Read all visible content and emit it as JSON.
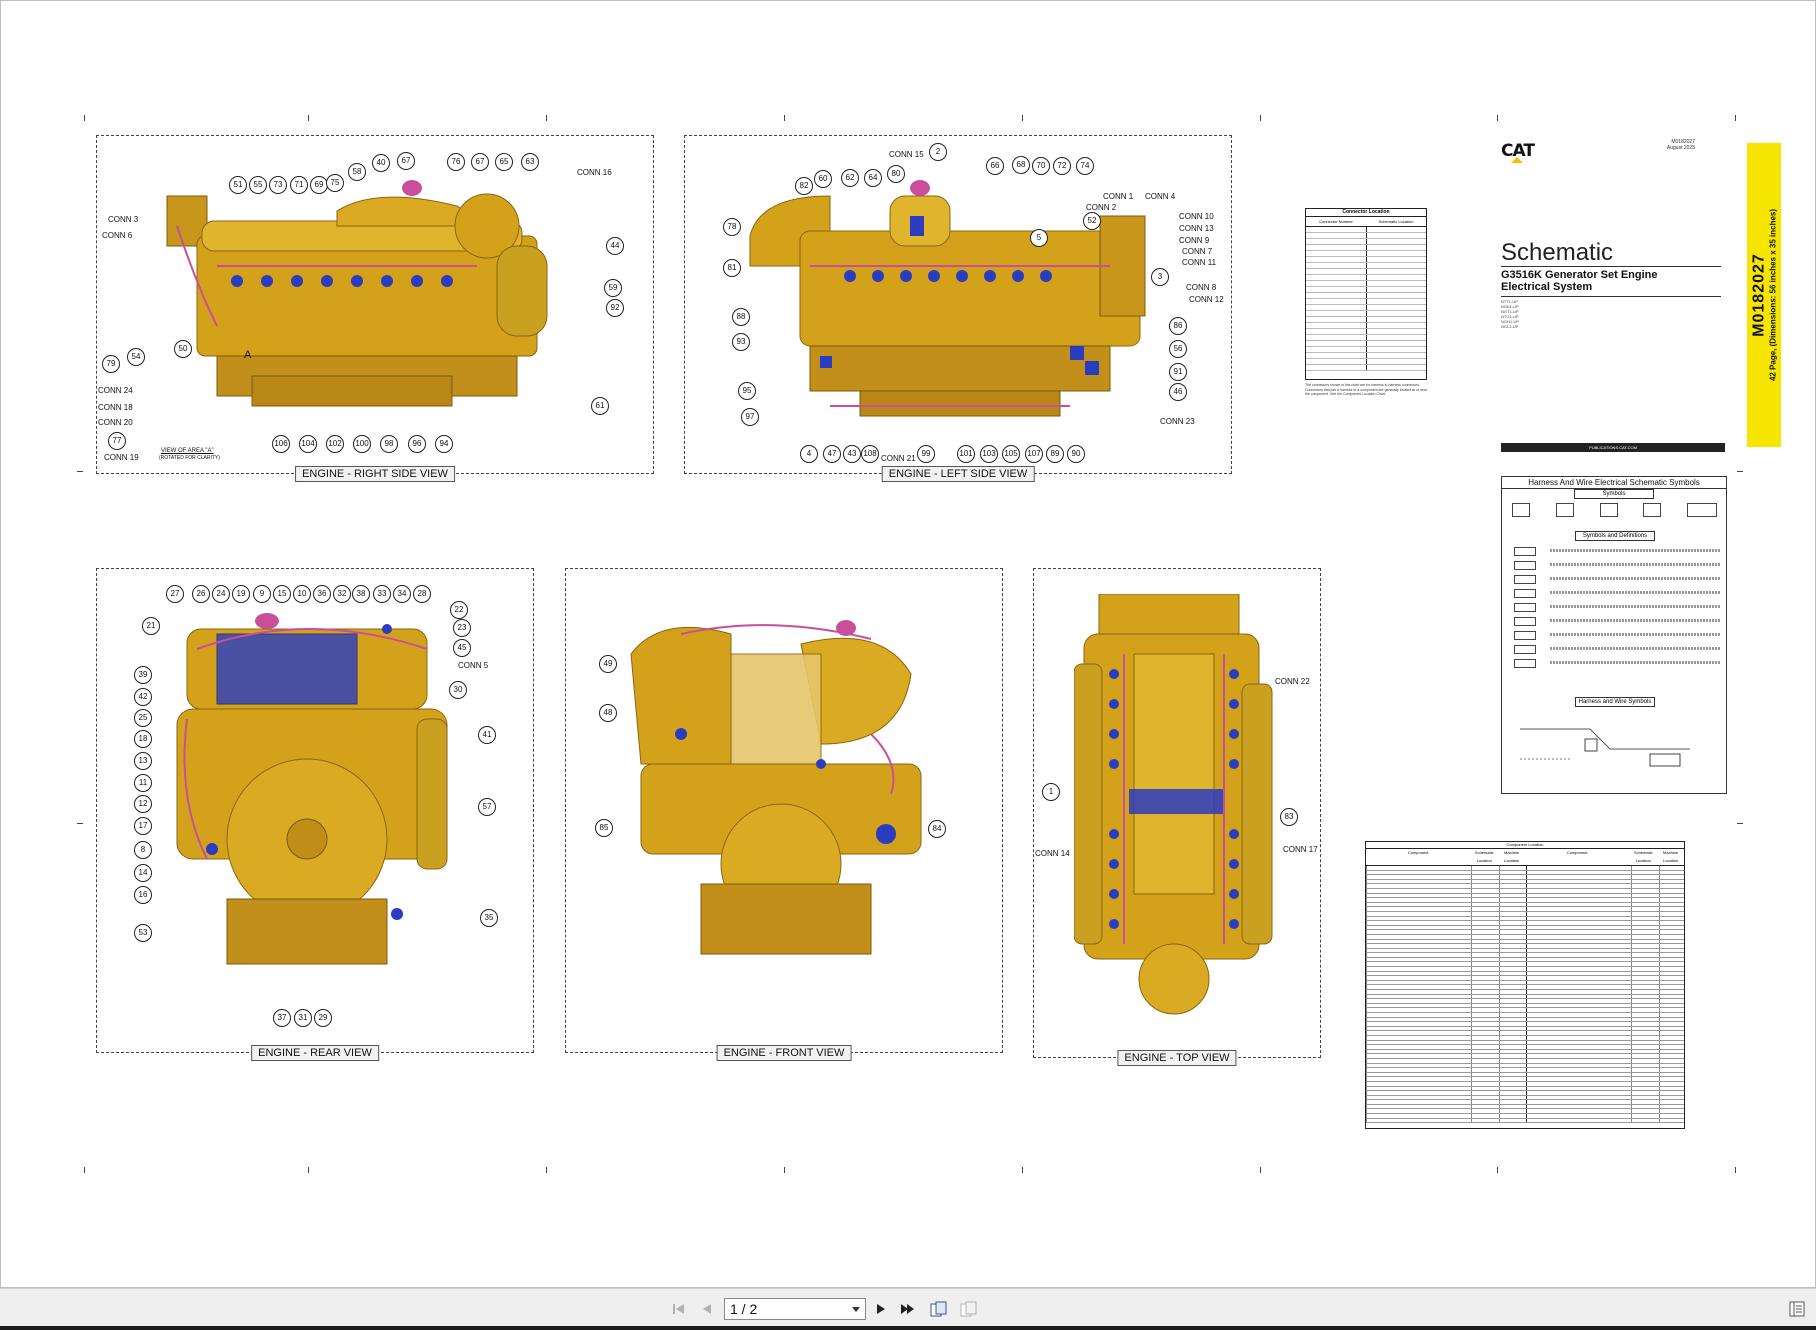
{
  "viewer": {
    "page_indicator": "1 / 2",
    "buttons": {
      "first": "first-page-icon",
      "prev": "previous-page-icon",
      "next": "next-page-icon",
      "last": "last-page-icon",
      "rotate_a": "page-layout-icon",
      "rotate_b": "page-layout-alt-icon",
      "sidebar": "sidebar-toggle-icon"
    }
  },
  "sheet": {
    "views": {
      "right": "ENGINE - RIGHT SIDE VIEW",
      "left": "ENGINE - LEFT SIDE VIEW",
      "rear": "ENGINE - REAR VIEW",
      "front": "ENGINE - FRONT VIEW",
      "top": "ENGINE - TOP VIEW"
    },
    "right_view": {
      "conns": [
        "CONN 3",
        "CONN 6",
        "CONN 16",
        "CONN 24",
        "CONN 18",
        "CONN 20",
        "CONN 19"
      ],
      "callouts": [
        "51",
        "55",
        "73",
        "71",
        "69",
        "75",
        "58",
        "40",
        "67",
        "76",
        "67",
        "65",
        "63",
        "44",
        "59",
        "92",
        "61",
        "106",
        "104",
        "102",
        "100",
        "98",
        "96",
        "94",
        "79",
        "54",
        "50",
        "77"
      ],
      "area_note": "VIEW OF AREA \"A\"",
      "area_note_2": "(ROTATED FOR CLARITY)",
      "area_letter": "A"
    },
    "left_view": {
      "conns": [
        "CONN 15",
        "CONN 1",
        "CONN 4",
        "CONN 2",
        "CONN 10",
        "CONN 13",
        "CONN 9",
        "CONN 7",
        "CONN 11",
        "CONN 8",
        "CONN 12",
        "CONN 23",
        "CONN 21"
      ],
      "callouts": [
        "2",
        "82",
        "60",
        "62",
        "64",
        "80",
        "66",
        "68",
        "70",
        "72",
        "74",
        "52",
        "78",
        "81",
        "88",
        "93",
        "95",
        "97",
        "3",
        "5",
        "86",
        "56",
        "91",
        "46",
        "4",
        "47",
        "43",
        "108",
        "99",
        "101",
        "103",
        "105",
        "107",
        "89",
        "90"
      ]
    },
    "rear_view": {
      "conns": [
        "CONN 5"
      ],
      "callouts": [
        "27",
        "26",
        "24",
        "19",
        "9",
        "15",
        "10",
        "36",
        "32",
        "38",
        "33",
        "34",
        "28",
        "22",
        "23",
        "45",
        "21",
        "39",
        "42",
        "25",
        "18",
        "13",
        "11",
        "12",
        "17",
        "8",
        "14",
        "16",
        "53",
        "30",
        "41",
        "57",
        "35",
        "37",
        "31",
        "29"
      ]
    },
    "front_view": {
      "callouts": [
        "49",
        "48",
        "85",
        "84"
      ]
    },
    "top_view": {
      "conns": [
        "CONN 22",
        "CONN 14",
        "CONN 17"
      ],
      "callouts": [
        "1",
        "83"
      ]
    },
    "title_block": {
      "brand": "CAT",
      "doc_meta_1": "M0182027",
      "doc_meta_2": "August 2025",
      "title": "Schematic",
      "subtitle": "G3516K Generator Set Engine Electrical System",
      "serials": [
        "NTT1-UP",
        "NGK1-UP",
        "NGT1-UP",
        "NTG1-UP",
        "NGH1-UP",
        "NGL1-UP"
      ],
      "doc_number": "M0182027",
      "pages_note": "42 Page, (Dimensions: 56 inches x 35 inches)",
      "pubs": "PUBLICATIONS.CAT.COM"
    },
    "connector_location": {
      "title": "Connector Location",
      "col1": "Connector Number",
      "col2": "Schematic Location",
      "note": "The connectors shown in this chart are for harness to harness connectors. Connectors that join a harness to a component are generally located at or near the component. See the Component Location Chart."
    },
    "symbols": {
      "title": "Harness And Wire Electrical Schematic Symbols",
      "sub1": "Symbols",
      "sub2": "Symbols and Definitions",
      "sub3": "Harness and Wire Symbols"
    },
    "component_location": {
      "title": "Component Location",
      "col_component": "Component",
      "col_schem": "Schematic Location",
      "col_machine": "Machine Location"
    }
  },
  "colors": {
    "engine": "#d4a21a",
    "harness": "#c94f9a",
    "sensor": "#2a3cc0",
    "yellow_band": "#f5e500"
  }
}
